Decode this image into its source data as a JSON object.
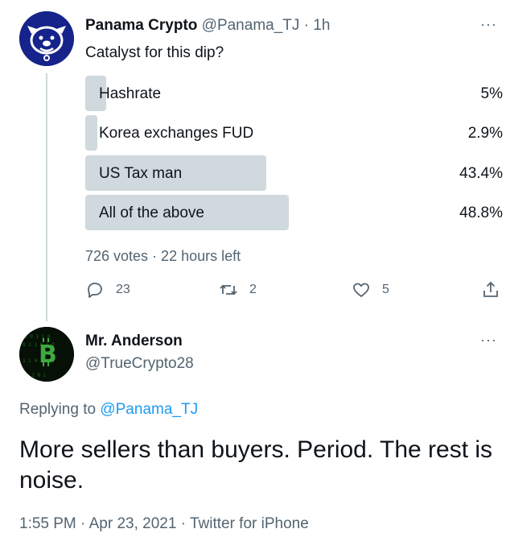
{
  "tweet1": {
    "display_name": "Panama Crypto",
    "handle": "@Panama_TJ",
    "separator": "·",
    "time": "1h",
    "more_label": "···",
    "text": "Catalyst for this dip?",
    "poll": {
      "options": [
        {
          "label": "Hashrate",
          "percent": "5%",
          "fraction": 0.05
        },
        {
          "label": "Korea exchanges FUD",
          "percent": "2.9%",
          "fraction": 0.029
        },
        {
          "label": "US Tax man",
          "percent": "43.4%",
          "fraction": 0.434
        },
        {
          "label": "All of the above",
          "percent": "48.8%",
          "fraction": 0.488
        }
      ],
      "summary": "726 votes · 22 hours left"
    },
    "actions": {
      "reply_count": "23",
      "retweet_count": "2",
      "like_count": "5"
    },
    "avatar_icon": "bulldog-icon"
  },
  "tweet2": {
    "display_name": "Mr. Anderson",
    "handle": "@TrueCrypto28",
    "more_label": "···",
    "avatar_icon": "bitcoin-matrix-icon",
    "replying_prefix": "Replying to ",
    "replying_handle": "@Panama_TJ",
    "text": "More sellers than buyers. Period. The rest is noise.",
    "meta": "1:55 PM · Apr 23, 2021 · Twitter for iPhone"
  },
  "colors": {
    "link": "#1d9bf0",
    "muted": "#536471",
    "poll_bar": "#cfd9de",
    "avatar1_bg": "#16238a"
  }
}
